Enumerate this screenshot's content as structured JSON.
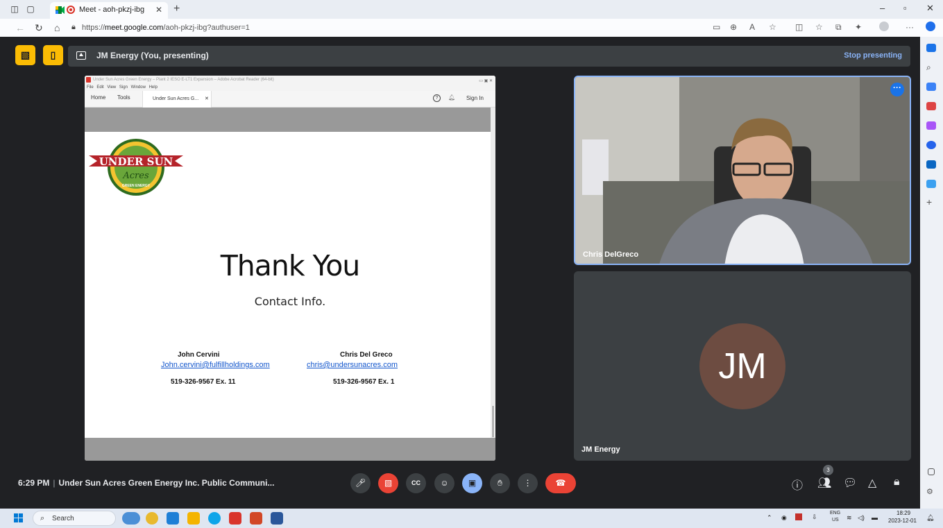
{
  "browser": {
    "tab_title": "Meet - aoh-pkzj-ibg",
    "url_prefix": "https://",
    "url_host": "meet.google.com",
    "url_path": "/aoh-pkzj-ibg?authuser=1"
  },
  "meet": {
    "presenting_label": "JM Energy (You, presenting)",
    "stop_presenting": "Stop presenting",
    "time": "6:29 PM",
    "meeting_title": "Under Sun Acres Green Energy Inc. Public Communi...",
    "participant_count": "3",
    "tiles": [
      {
        "name": "Chris DelGreco"
      },
      {
        "name": "JM Energy",
        "initials": "JM"
      }
    ]
  },
  "acrobat": {
    "window_title": "Under Sun Acres Green Energy – Plant 2 IESO E-LT1 Expansion – Adobe Acrobat Reader (64-bit)",
    "menu": "File  Edit  View  Sign  Window  Help",
    "tab_home": "Home",
    "tab_tools": "Tools",
    "doc_tab": "Under Sun Acres G...",
    "sign_in": "Sign In"
  },
  "slide": {
    "logo_text_top": "UNDER SUN",
    "logo_text_mid": "Acres",
    "logo_text_bottom": "GREEN ENERGY",
    "heading": "Thank You",
    "subheading": "Contact Info.",
    "contacts": [
      {
        "name": "John Cervini",
        "email": "John.cervini@fulfillholdings.com",
        "phone": "519-326-9567 Ex. 11"
      },
      {
        "name": "Chris Del Greco",
        "email": "chris@undersunacres.com",
        "phone": "519-326-9567 Ex. 1"
      }
    ]
  },
  "taskbar": {
    "search_label": "Search",
    "lang_top": "ENG",
    "lang_bottom": "US",
    "clock_time": "18:29",
    "clock_date": "2023-12-01"
  },
  "colors": {
    "meet_bg": "#202124",
    "accent_blue": "#8ab4f8",
    "end_call_red": "#ea4335",
    "yellow": "#fbbc04",
    "avatar_brown": "#6d4c41"
  }
}
